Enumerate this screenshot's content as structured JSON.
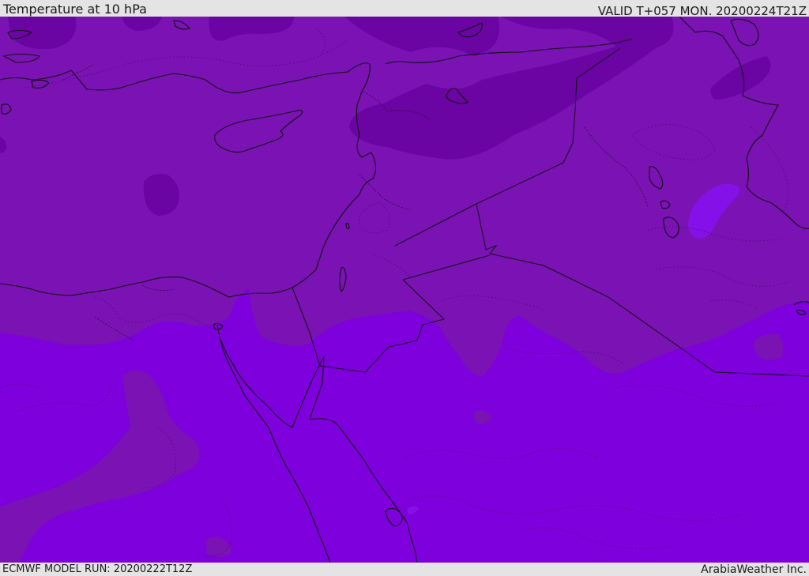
{
  "header": {
    "title": "Temperature at 10 hPa",
    "valid_time": "VALID T+057 MON. 20200224T21Z"
  },
  "footer": {
    "model_run": "ECMWF MODEL RUN: 20200222T12Z",
    "credit": "ArabiaWeather Inc."
  },
  "map": {
    "colors": {
      "base_field": "#7a12b4",
      "cold_band": "#6a04a2",
      "warm_band": "#7e00dc",
      "warm_band_light": "#8610e8",
      "coastline": "#111111",
      "border": "#222222"
    }
  }
}
